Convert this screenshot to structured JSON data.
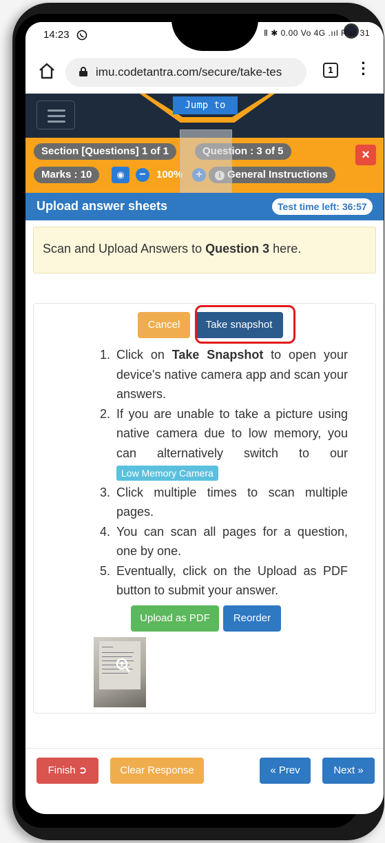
{
  "status_bar": {
    "time": "14:23",
    "whatsapp_icon": "whatsapp-icon",
    "right": "Ⅱ ✱ 0.00 Vo 4G .ııl R.ııl 31"
  },
  "browser": {
    "url": "imu.codetantra.com/secure/take-tes",
    "tab_count": "1"
  },
  "navbar": {
    "jump_label": "Jump to"
  },
  "info": {
    "section": "Section [Questions] 1 of 1",
    "question": "Question : 3 of 5",
    "marks": "Marks : 10",
    "zoom": "100%",
    "general_instructions": "General Instructions"
  },
  "title_bar": {
    "title": "Upload answer sheets",
    "time_left": "Test time left: 36:57"
  },
  "alert": {
    "prefix": "Scan and Upload Answers to ",
    "question": "Question 3",
    "suffix": " here."
  },
  "upload": {
    "cancel_label": "Cancel",
    "snapshot_label": "Take snapshot",
    "upload_pdf_label": "Upload as PDF",
    "reorder_label": "Reorder",
    "low_memory_label": "Low Memory Camera"
  },
  "instructions": [
    {
      "num": "1.",
      "pre": "Click on ",
      "bold": "Take Snapshot",
      "post": " to open your device's native camera app and scan your answers."
    },
    {
      "num": "2.",
      "pre": "If you are unable to take a picture using native camera due to low memory, you can alternatively switch to our ",
      "bold": "",
      "post": ""
    },
    {
      "num": "3.",
      "pre": "Click multiple times to scan multiple pages.",
      "bold": "",
      "post": ""
    },
    {
      "num": "4.",
      "pre": "You can scan all pages for a question, one by one.",
      "bold": "",
      "post": ""
    },
    {
      "num": "5.",
      "pre": "Eventually, click on the Upload as PDF button to submit your answer.",
      "bold": "",
      "post": ""
    }
  ],
  "footer": {
    "finish_label": "Finish",
    "clear_label": "Clear Response",
    "prev_label": "« Prev",
    "next_label": "Next »"
  },
  "colors": {
    "nav": "#1e2b3c",
    "orange": "#f8a31b",
    "blue": "#2f78c2",
    "red": "#e74c3c",
    "green": "#5cb85c",
    "cyan": "#5bc0de"
  }
}
